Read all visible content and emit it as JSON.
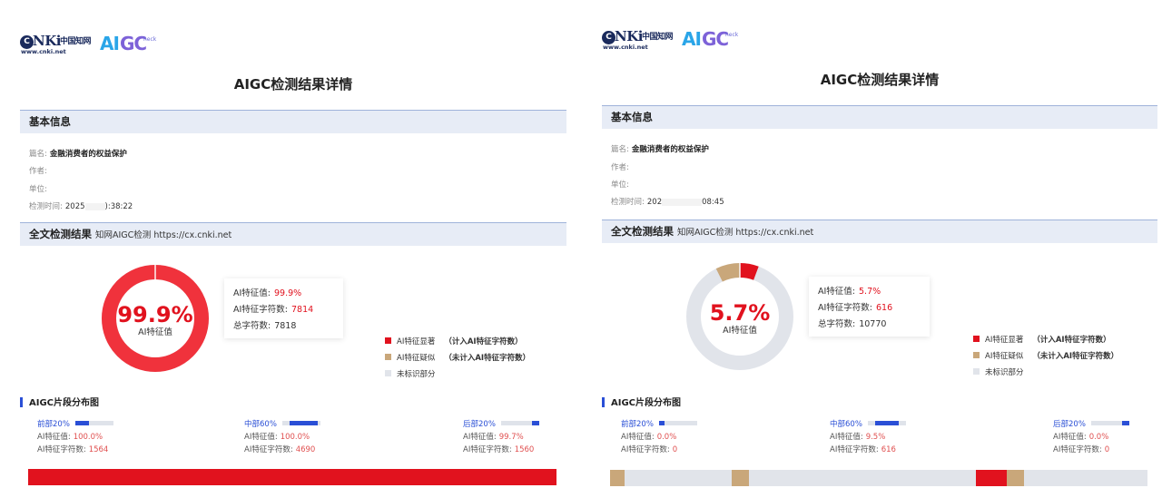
{
  "logo": {
    "cnki": "NKi",
    "cnki_cn": "中国知网",
    "cnki_url": "www.cnki.net",
    "aigc_ai": "AI",
    "aigc_gc": "GC",
    "aigc_heck": "heck"
  },
  "reports": [
    {
      "title": "AIGC检测结果详情",
      "basic_header": "基本信息",
      "label_title": "篇名:",
      "paper_title": "金融消费者的权益保护",
      "label_author": "作者:",
      "label_unit": "单位:",
      "label_time": "检测时间:",
      "time_start": "2025",
      "time_end": "):38:22",
      "result_header": "全文检测结果",
      "result_sub": "知网AIGC检测   https://cx.cnki.net",
      "donut_pct": "99.9%",
      "donut_label": "AI特征值",
      "donut_fraction": 0.999,
      "stat_ai_label": "AI特征值:",
      "stat_ai_value": "99.9%",
      "stat_chars_label": "AI特征字符数:",
      "stat_chars_value": "7814",
      "stat_total_label": "总字符数:",
      "stat_total_value": "7818",
      "legend": [
        {
          "label": "AI特征显著",
          "note": "（计入AI特征字符数）",
          "color": "#e1121e"
        },
        {
          "label": "AI特征疑似",
          "note": "（未计入AI特征字符数）",
          "color": "#c9a77a"
        },
        {
          "label": "未标识部分",
          "note": "",
          "color": "#e1e4ea"
        }
      ],
      "dist_title": "AIGC片段分布图",
      "segments": [
        {
          "name": "前部20%",
          "ai_label": "AI特征值:",
          "ai_value": "100.0%",
          "chars_label": "AI特征字符数:",
          "chars_value": "1564",
          "fraction": 1.0
        },
        {
          "name": "中部60%",
          "ai_label": "AI特征值:",
          "ai_value": "100.0%",
          "chars_label": "AI特征字符数:",
          "chars_value": "4690",
          "fraction": 1.0
        },
        {
          "name": "后部20%",
          "ai_label": "AI特征值:",
          "ai_value": "99.7%",
          "chars_label": "AI特征字符数:",
          "chars_value": "1560",
          "fraction": 0.997
        }
      ],
      "distribution": [
        {
          "start": 0.0,
          "end": 1.0,
          "kind": "significant"
        }
      ]
    },
    {
      "title": "AIGC检测结果详情",
      "basic_header": "基本信息",
      "label_title": "篇名:",
      "paper_title": "金融消费者的权益保护",
      "label_author": "作者:",
      "label_unit": "单位:",
      "label_time": "检测时间:",
      "time_start": "202",
      "time_end": "08:45",
      "result_header": "全文检测结果",
      "result_sub": "知网AIGC检测   https://cx.cnki.net",
      "donut_pct": "5.7%",
      "donut_label": "AI特征值",
      "donut_fraction": 0.057,
      "donut_suspect_fraction": 0.075,
      "stat_ai_label": "AI特征值:",
      "stat_ai_value": "5.7%",
      "stat_chars_label": "AI特征字符数:",
      "stat_chars_value": "616",
      "stat_total_label": "总字符数:",
      "stat_total_value": "10770",
      "legend": [
        {
          "label": "AI特征显著",
          "note": "（计入AI特征字符数）",
          "color": "#e1121e"
        },
        {
          "label": "AI特征疑似",
          "note": "（未计入AI特征字符数）",
          "color": "#c9a77a"
        },
        {
          "label": "未标识部分",
          "note": "",
          "color": "#e1e4ea"
        }
      ],
      "dist_title": "AIGC片段分布图",
      "segments": [
        {
          "name": "前部20%",
          "ai_label": "AI特征值:",
          "ai_value": "0.0%",
          "chars_label": "AI特征字符数:",
          "chars_value": "0",
          "fraction": 0.15
        },
        {
          "name": "中部60%",
          "ai_label": "AI特征值:",
          "ai_value": "9.5%",
          "chars_label": "AI特征字符数:",
          "chars_value": "616",
          "fraction": 0.8
        },
        {
          "name": "后部20%",
          "ai_label": "AI特征值:",
          "ai_value": "0.0%",
          "chars_label": "AI特征字符数:",
          "chars_value": "0",
          "fraction": 0.2
        }
      ],
      "distribution": [
        {
          "start": 0.0,
          "end": 0.027,
          "kind": "suspect"
        },
        {
          "start": 0.227,
          "end": 0.259,
          "kind": "suspect"
        },
        {
          "start": 0.68,
          "end": 0.738,
          "kind": "significant"
        },
        {
          "start": 0.738,
          "end": 0.771,
          "kind": "suspect"
        }
      ]
    }
  ]
}
